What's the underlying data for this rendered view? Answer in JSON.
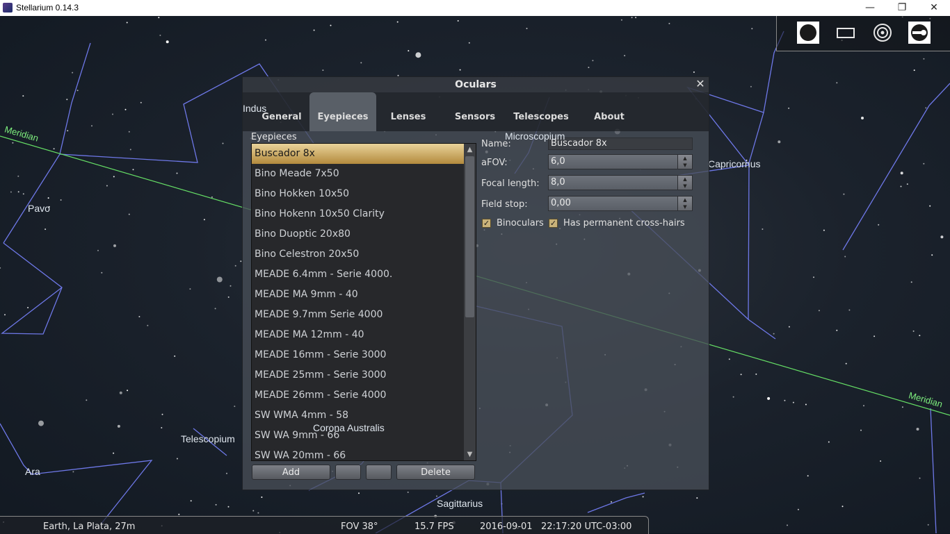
{
  "window": {
    "title": "Stellarium 0.14.3",
    "minimize": "—",
    "restore": "❐",
    "close": "✕"
  },
  "sky": {
    "labels": {
      "meridian_left": "Meridian",
      "meridian_right": "Meridian",
      "indus": "Indus",
      "pavo": "Pavo",
      "microscopium": "Microscopium",
      "capricornus": "Capricornus",
      "telescopium": "Telescopium",
      "ara": "Ara",
      "corona_australis": "Corona Australis",
      "sagittarius": "Sagittarius"
    },
    "colors": {
      "constellation_lines": "#6e78e8",
      "meridian": "#66e066"
    }
  },
  "dialog": {
    "title": "Oculars",
    "close_icon": "close-icon",
    "tabs": [
      "General",
      "Eyepieces",
      "Lenses",
      "Sensors",
      "Telescopes",
      "About"
    ],
    "active_tab": "Eyepieces",
    "section_label": "Eyepieces",
    "eyepieces": [
      "Buscador 8x",
      "Bino Meade 7x50",
      "Bino Hokken 10x50",
      "Bino Hokenn 10x50 Clarity",
      "Bino Duoptic 20x80",
      "Bino Celestron 20x50",
      "MEADE 6.4mm - Serie 4000.",
      "MEADE MA 9mm - 40",
      "MEADE 9.7mm Serie 4000",
      "MEADE MA 12mm - 40",
      "MEADE 16mm - Serie 3000",
      "MEADE 25mm - Serie 3000",
      "MEADE 26mm - Serie 4000",
      "SW WMA 4mm - 58",
      "SW WA 9mm - 66",
      "SW WA 20mm - 66"
    ],
    "selected_index": 0,
    "buttons": {
      "add": "Add",
      "up": "",
      "down": "",
      "delete": "Delete"
    },
    "form": {
      "name_label": "Name:",
      "name_value": "Buscador 8x",
      "afov_label": "aFOV:",
      "afov_value": "6,0",
      "focal_label": "Focal length:",
      "focal_value": "8,0",
      "fieldstop_label": "Field stop:",
      "fieldstop_value": "0,00",
      "binoculars_label": "Binoculars",
      "binoculars_checked": true,
      "crosshairs_label": "Has permanent cross-hairs",
      "crosshairs_checked": true,
      "check_mark": "✓"
    },
    "colors": {
      "selected_gradient_top": "#e9d39a",
      "selected_gradient_bottom": "#b38a3d"
    }
  },
  "toolbar": {
    "icons": [
      "ocular-view-icon",
      "ccd-sensor-icon",
      "telrad-icon",
      "ocular-config-icon"
    ]
  },
  "status": {
    "location": "Earth, La Plata, 27m",
    "fov": "FOV 38°",
    "fps": "15.7 FPS",
    "datetime": "2016-09-01   22:17:20 UTC-03:00"
  }
}
